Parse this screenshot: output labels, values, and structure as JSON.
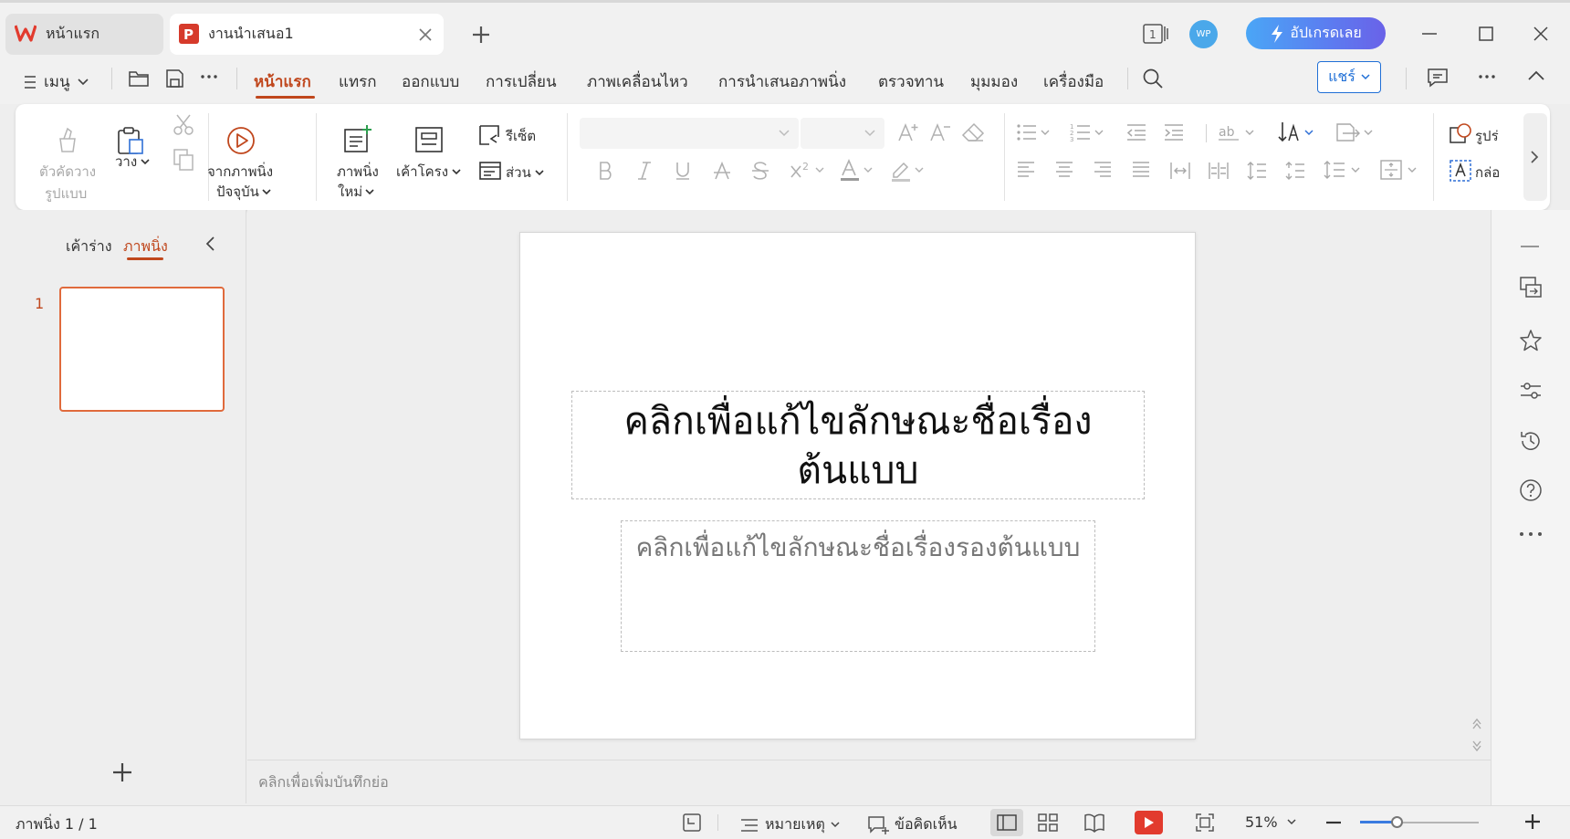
{
  "tabs": [
    {
      "label": "หน้าแรก",
      "icon": "wps-logo-icon"
    },
    {
      "label": "งานนำเสนอ1",
      "icon": "presentation-file-icon"
    }
  ],
  "titlebar": {
    "badge_number": "1",
    "avatar_text": "WP",
    "upgrade_label": "อัปเกรดเลย"
  },
  "menu": {
    "menu_label": "เมนู",
    "items": [
      "หน้าแรก",
      "แทรก",
      "ออกแบบ",
      "การเปลี่ยน",
      "ภาพเคลื่อนไหว",
      "การนำเสนอภาพนิ่ง",
      "ตรวจทาน",
      "มุมมอง",
      "เครื่องมือ"
    ],
    "active_index": 0,
    "share_label": "แชร์"
  },
  "ribbon": {
    "format_painter": [
      "ตัวคัดวาง",
      "รูปแบบ"
    ],
    "paste": "วาง",
    "from_current": [
      "จากภาพนิ่ง",
      "ปัจจุบัน"
    ],
    "new_slide": [
      "ภาพนิ่ง",
      "ใหม่"
    ],
    "layout": "เค้าโครง",
    "reset": "รีเซ็ต",
    "section": "ส่วน",
    "shape_partial": "รูปร่",
    "textbox_partial": "กล่อ"
  },
  "panel": {
    "tab_outline": "เค้าร่าง",
    "tab_slides": "ภาพนิ่ง",
    "slide_number": "1"
  },
  "slide": {
    "title": "คลิกเพื่อแก้ไขลักษณะชื่อเรื่องต้นแบบ",
    "subtitle": "คลิกเพื่อแก้ไขลักษณะชื่อเรื่องรองต้นแบบ"
  },
  "notes_placeholder": "คลิกเพื่อเพิ่มบันทึกย่อ",
  "status": {
    "slide_info": "ภาพนิ่ง 1 / 1",
    "notes_label": "หมายเหตุ",
    "comments_label": "ข้อคิดเห็น",
    "zoom": "51%",
    "zoom_fraction": 0.51
  },
  "colors": {
    "accent": "#c0471d",
    "share_blue": "#1f6fd6",
    "play_red": "#e23b2e"
  }
}
